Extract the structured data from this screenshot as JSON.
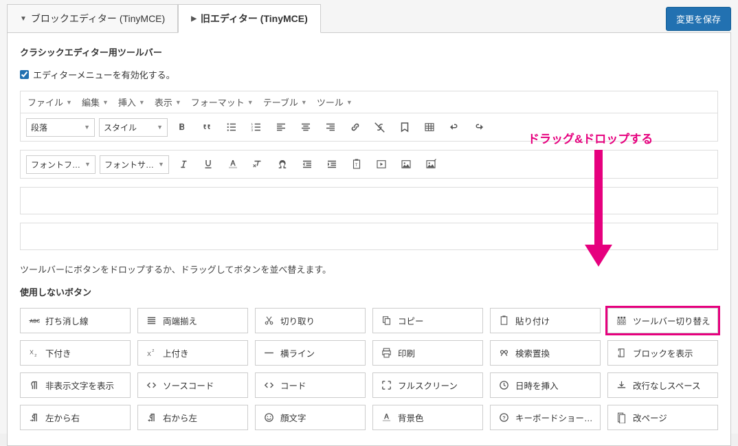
{
  "tabs": {
    "block": "ブロックエディター (TinyMCE)",
    "classic": "旧エディター (TinyMCE)"
  },
  "save_btn": "変更を保存",
  "section_heading": "クラシックエディター用ツールバー",
  "enable_menu_label": "エディターメニューを有効化する。",
  "menubar": [
    "ファイル",
    "編集",
    "挿入",
    "表示",
    "フォーマット",
    "テーブル",
    "ツール"
  ],
  "row1": {
    "format_dropdown": "段落",
    "style_dropdown": "スタイル"
  },
  "row2": {
    "fontfamily": "フォントフ…",
    "fontsize": "フォントサ…"
  },
  "help_text": "ツールバーにボタンをドロップするか、ドラッグしてボタンを並べ替えます。",
  "unused_heading": "使用しないボタン",
  "unused": [
    {
      "id": "strike",
      "label": "打ち消し線"
    },
    {
      "id": "justify",
      "label": "両端揃え"
    },
    {
      "id": "cut",
      "label": "切り取り"
    },
    {
      "id": "copy",
      "label": "コピー"
    },
    {
      "id": "paste",
      "label": "貼り付け"
    },
    {
      "id": "toggle",
      "label": "ツールバー切り替え"
    },
    {
      "id": "sub",
      "label": "下付き"
    },
    {
      "id": "sup",
      "label": "上付き"
    },
    {
      "id": "hr",
      "label": "横ライン"
    },
    {
      "id": "print",
      "label": "印刷"
    },
    {
      "id": "find",
      "label": "検索置換"
    },
    {
      "id": "blocks",
      "label": "ブロックを表示"
    },
    {
      "id": "invis",
      "label": "非表示文字を表示"
    },
    {
      "id": "source",
      "label": "ソースコード"
    },
    {
      "id": "code",
      "label": "コード"
    },
    {
      "id": "fullscreen",
      "label": "フルスクリーン"
    },
    {
      "id": "datetime",
      "label": "日時を挿入"
    },
    {
      "id": "nbsp",
      "label": "改行なしスペース"
    },
    {
      "id": "ltr",
      "label": "左から右"
    },
    {
      "id": "rtl",
      "label": "右から左"
    },
    {
      "id": "emoji",
      "label": "顔文字"
    },
    {
      "id": "bgcolor",
      "label": "背景色"
    },
    {
      "id": "kbshort",
      "label": "キーボードショー…"
    },
    {
      "id": "pagebreak",
      "label": "改ページ"
    }
  ],
  "annotation": "ドラッグ&ドロップする"
}
